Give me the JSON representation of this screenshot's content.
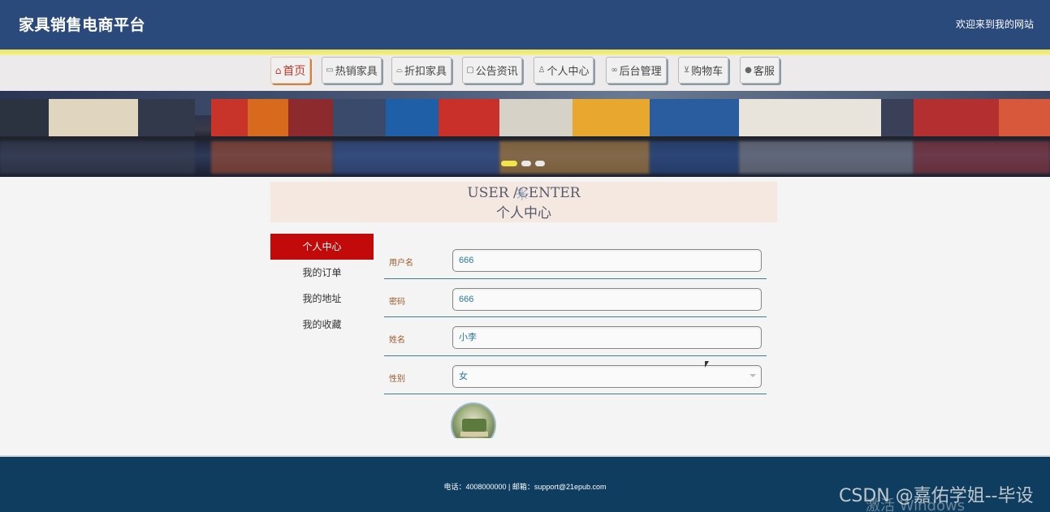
{
  "header": {
    "title": "家具销售电商平台",
    "welcome": "欢迎来到我的网站"
  },
  "nav": [
    {
      "icon": "home-icon",
      "glyph": "⌂",
      "label": "首页",
      "active": true
    },
    {
      "icon": "sofa-icon",
      "glyph": "▭",
      "label": "热销家具"
    },
    {
      "icon": "graduation-icon",
      "glyph": "⌓",
      "label": "折扣家具"
    },
    {
      "icon": "document-icon",
      "glyph": "▢",
      "label": "公告资讯"
    },
    {
      "icon": "user-icon",
      "glyph": "♙",
      "label": "个人中心"
    },
    {
      "icon": "link-icon",
      "glyph": "∞",
      "label": "后台管理"
    },
    {
      "icon": "cart-icon",
      "glyph": "⊻",
      "label": "购物车"
    },
    {
      "icon": "service-icon",
      "glyph": "●",
      "label": "客服"
    }
  ],
  "banner": {
    "slides": 3,
    "active_slide": 1
  },
  "user_center": {
    "title_en": "USER /CENTER",
    "title_cn": "个人中心"
  },
  "side_menu": [
    {
      "label": "个人中心",
      "active": true
    },
    {
      "label": "我的订单"
    },
    {
      "label": "我的地址"
    },
    {
      "label": "我的收藏"
    }
  ],
  "form": {
    "username": {
      "label": "用户名",
      "value": "666"
    },
    "password": {
      "label": "密码",
      "value": "666"
    },
    "name": {
      "label": "姓名",
      "value": "小李"
    },
    "gender": {
      "label": "性别",
      "value": "女"
    }
  },
  "footer": {
    "text": "电话：4008000000 | 邮箱：support@21epub.com"
  },
  "overlay": {
    "watermark": "CSDN @嘉佑学姐--毕设",
    "windows": "激活 Windows"
  },
  "colors": {
    "topbar": "#2b4a7c",
    "accent_red": "#c20a0a",
    "footer": "#0e3d5f",
    "stripe": "#f1e34a"
  }
}
